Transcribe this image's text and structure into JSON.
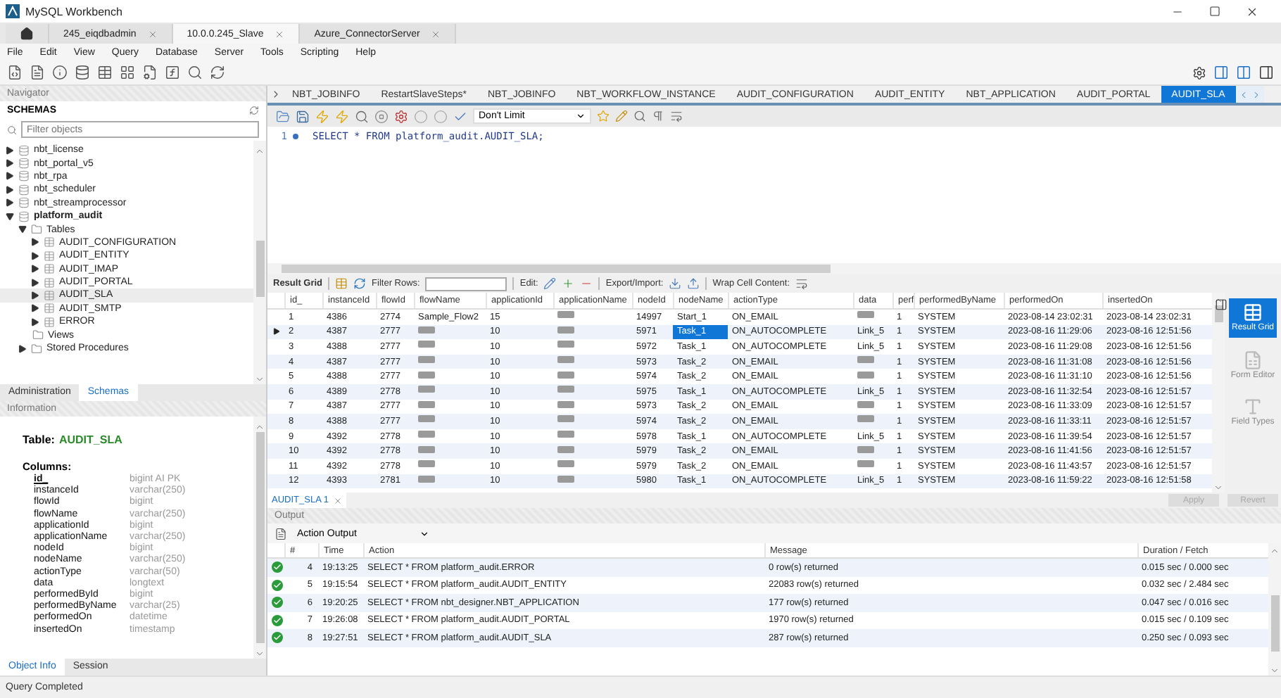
{
  "window": {
    "title": "MySQL Workbench"
  },
  "connection_tabs": [
    {
      "label": "245_eiqdbadmin",
      "selected": false
    },
    {
      "label": "10.0.0.245_Slave",
      "selected": true
    },
    {
      "label": "Azure_ConnectorServer",
      "selected": false
    }
  ],
  "menu": [
    "File",
    "Edit",
    "View",
    "Query",
    "Database",
    "Server",
    "Tools",
    "Scripting",
    "Help"
  ],
  "navigator": {
    "title": "Navigator",
    "section": "SCHEMAS",
    "filter": {
      "placeholder": "Filter objects"
    },
    "tree": [
      {
        "label": "nbt_license",
        "expanded": false
      },
      {
        "label": "nbt_portal_v5",
        "expanded": false
      },
      {
        "label": "nbt_rpa",
        "expanded": false
      },
      {
        "label": "nbt_scheduler",
        "expanded": false
      },
      {
        "label": "nbt_streamprocessor",
        "expanded": false
      },
      {
        "label": "platform_audit",
        "expanded": true,
        "children": [
          {
            "label": "Tables",
            "kind": "folder",
            "expanded": true,
            "children": [
              {
                "label": "AUDIT_CONFIGURATION",
                "kind": "table",
                "selected": false,
                "expanded": false
              },
              {
                "label": "AUDIT_ENTITY",
                "kind": "table",
                "selected": false,
                "expanded": false
              },
              {
                "label": "AUDIT_IMAP",
                "kind": "table",
                "selected": false,
                "expanded": false
              },
              {
                "label": "AUDIT_PORTAL",
                "kind": "table",
                "selected": false,
                "expanded": false
              },
              {
                "label": "AUDIT_SLA",
                "kind": "table",
                "selected": true,
                "expanded": false
              },
              {
                "label": "AUDIT_SMTP",
                "kind": "table",
                "selected": false,
                "expanded": false
              },
              {
                "label": "ERROR",
                "kind": "table",
                "selected": false,
                "expanded": false
              }
            ]
          },
          {
            "label": "Views",
            "kind": "folder"
          },
          {
            "label": "Stored Procedures",
            "kind": "folder",
            "expanded": false
          }
        ]
      }
    ],
    "tabs": [
      {
        "label": "Administration",
        "selected": false
      },
      {
        "label": "Schemas",
        "selected": true
      }
    ]
  },
  "information": {
    "title": "Information",
    "table_label": "Table:",
    "table_name": "AUDIT_SLA",
    "columns_label": "Columns:",
    "columns": [
      {
        "name": "id_",
        "type": "bigint AI PK",
        "primary": true
      },
      {
        "name": "instanceId",
        "type": "varchar(250)",
        "primary": false
      },
      {
        "name": "flowId",
        "type": "bigint",
        "primary": false
      },
      {
        "name": "flowName",
        "type": "varchar(250)",
        "primary": false
      },
      {
        "name": "applicationId",
        "type": "bigint",
        "primary": false
      },
      {
        "name": "applicationName",
        "type": "varchar(250)",
        "primary": false
      },
      {
        "name": "nodeId",
        "type": "bigint",
        "primary": false
      },
      {
        "name": "nodeName",
        "type": "varchar(250)",
        "primary": false
      },
      {
        "name": "actionType",
        "type": "varchar(50)",
        "primary": false
      },
      {
        "name": "data",
        "type": "longtext",
        "primary": false
      },
      {
        "name": "performedById",
        "type": "bigint",
        "primary": false
      },
      {
        "name": "performedByName",
        "type": "varchar(25)",
        "primary": false
      },
      {
        "name": "performedOn",
        "type": "datetime",
        "primary": false
      },
      {
        "name": "insertedOn",
        "type": "timestamp",
        "primary": false
      }
    ],
    "tabs": [
      {
        "label": "Object Info",
        "selected": true
      },
      {
        "label": "Session",
        "selected": false
      }
    ]
  },
  "editor_tabs": [
    {
      "label": "NBT_JOBINFO",
      "selected": false
    },
    {
      "label": "RestartSlaveSteps*",
      "selected": false
    },
    {
      "label": "NBT_JOBINFO",
      "selected": false
    },
    {
      "label": "NBT_WORKFLOW_INSTANCE",
      "selected": false
    },
    {
      "label": "AUDIT_CONFIGURATION",
      "selected": false
    },
    {
      "label": "AUDIT_ENTITY",
      "selected": false
    },
    {
      "label": "NBT_APPLICATION",
      "selected": false
    },
    {
      "label": "AUDIT_PORTAL",
      "selected": false
    },
    {
      "label": "AUDIT_SLA",
      "selected": true
    }
  ],
  "limit_select": {
    "value": "Don't Limit"
  },
  "editor": {
    "lines": [
      {
        "number": "1",
        "code": "SELECT * FROM platform_audit.AUDIT_SLA;"
      }
    ]
  },
  "result_toolbar": {
    "result_grid": "Result Grid",
    "filter_label": "Filter Rows:",
    "edit_label": "Edit:",
    "export_label": "Export/Import:",
    "wrap_label": "Wrap Cell Content:"
  },
  "result_grid": {
    "columns": [
      {
        "label": "id_",
        "selected": false
      },
      {
        "label": "instanceId",
        "selected": false
      },
      {
        "label": "flowId",
        "selected": false
      },
      {
        "label": "flowName",
        "selected": false
      },
      {
        "label": "applicationId",
        "selected": false
      },
      {
        "label": "applicationName",
        "selected": false
      },
      {
        "label": "nodeId",
        "selected": false
      },
      {
        "label": "nodeName",
        "selected": true
      },
      {
        "label": "actionType",
        "selected": false
      },
      {
        "label": "data",
        "selected": false
      },
      {
        "label": "perf",
        "selected": false
      },
      {
        "label": "performedByName",
        "selected": false
      },
      {
        "label": "performedOn",
        "selected": false
      },
      {
        "label": "insertedOn",
        "selected": false
      }
    ],
    "rows": [
      {
        "current": false,
        "cells": [
          "1",
          "4386",
          "2774",
          "Sample_Flow2",
          "15",
          null,
          "14997",
          "Start_1",
          "ON_EMAIL",
          null,
          "1",
          "SYSTEM",
          "2023-08-14 23:02:31",
          "2023-08-14 23:02:31"
        ]
      },
      {
        "current": true,
        "cells": [
          "2",
          "4387",
          "2777",
          null,
          "10",
          null,
          "5971",
          "Task_1",
          "ON_AUTOCOMPLETE",
          "Link_5",
          "1",
          "SYSTEM",
          "2023-08-16 11:29:06",
          "2023-08-16 12:51:56"
        ]
      },
      {
        "current": false,
        "cells": [
          "3",
          "4388",
          "2777",
          null,
          "10",
          null,
          "5972",
          "Task_1",
          "ON_AUTOCOMPLETE",
          "Link_5",
          "1",
          "SYSTEM",
          "2023-08-16 11:29:08",
          "2023-08-16 12:51:56"
        ]
      },
      {
        "current": false,
        "cells": [
          "4",
          "4387",
          "2777",
          null,
          "10",
          null,
          "5973",
          "Task_2",
          "ON_EMAIL",
          null,
          "1",
          "SYSTEM",
          "2023-08-16 11:31:08",
          "2023-08-16 12:51:56"
        ]
      },
      {
        "current": false,
        "cells": [
          "5",
          "4388",
          "2777",
          null,
          "10",
          null,
          "5974",
          "Task_2",
          "ON_EMAIL",
          null,
          "1",
          "SYSTEM",
          "2023-08-16 11:31:10",
          "2023-08-16 12:51:56"
        ]
      },
      {
        "current": false,
        "cells": [
          "6",
          "4389",
          "2778",
          null,
          "10",
          null,
          "5975",
          "Task_1",
          "ON_AUTOCOMPLETE",
          "Link_5",
          "1",
          "SYSTEM",
          "2023-08-16 11:32:54",
          "2023-08-16 12:51:57"
        ]
      },
      {
        "current": false,
        "cells": [
          "7",
          "4387",
          "2777",
          null,
          "10",
          null,
          "5973",
          "Task_2",
          "ON_EMAIL",
          null,
          "1",
          "SYSTEM",
          "2023-08-16 11:33:09",
          "2023-08-16 12:51:57"
        ]
      },
      {
        "current": false,
        "cells": [
          "8",
          "4388",
          "2777",
          null,
          "10",
          null,
          "5974",
          "Task_2",
          "ON_EMAIL",
          null,
          "1",
          "SYSTEM",
          "2023-08-16 11:33:11",
          "2023-08-16 12:51:57"
        ]
      },
      {
        "current": false,
        "cells": [
          "9",
          "4392",
          "2778",
          null,
          "10",
          null,
          "5978",
          "Task_1",
          "ON_AUTOCOMPLETE",
          "Link_5",
          "1",
          "SYSTEM",
          "2023-08-16 11:39:54",
          "2023-08-16 12:51:57"
        ]
      },
      {
        "current": false,
        "cells": [
          "10",
          "4392",
          "2778",
          null,
          "10",
          null,
          "5979",
          "Task_2",
          "ON_EMAIL",
          null,
          "1",
          "SYSTEM",
          "2023-08-16 11:41:56",
          "2023-08-16 12:51:57"
        ]
      },
      {
        "current": false,
        "cells": [
          "11",
          "4392",
          "2778",
          null,
          "10",
          null,
          "5979",
          "Task_2",
          "ON_EMAIL",
          null,
          "1",
          "SYSTEM",
          "2023-08-16 11:43:57",
          "2023-08-16 12:51:57"
        ]
      },
      {
        "current": false,
        "cells": [
          "12",
          "4393",
          "2781",
          null,
          "10",
          null,
          "5980",
          "Task_1",
          "ON_AUTOCOMPLETE",
          "Link_5",
          "1",
          "SYSTEM",
          "2023-08-16 11:59:22",
          "2023-08-16 12:51:58"
        ]
      }
    ]
  },
  "side_panel": [
    {
      "label": "Result Grid",
      "selected": true
    },
    {
      "label": "Form Editor",
      "selected": false
    },
    {
      "label": "Field Types",
      "selected": false
    }
  ],
  "result_tab": {
    "label": "AUDIT_SLA 1"
  },
  "buttons": [
    {
      "label": "Apply",
      "disabled": true
    },
    {
      "label": "Revert",
      "disabled": true
    }
  ],
  "output": {
    "title": "Output",
    "mode": "Action Output",
    "columns": [
      "#",
      "Time",
      "Action",
      "Message",
      "Duration / Fetch"
    ],
    "rows": [
      {
        "success": true,
        "cells": [
          "4",
          "19:13:25",
          "SELECT * FROM platform_audit.ERROR",
          "0 row(s) returned",
          "0.015 sec / 0.000 sec"
        ]
      },
      {
        "success": true,
        "cells": [
          "5",
          "19:15:54",
          "SELECT * FROM platform_audit.AUDIT_ENTITY",
          "22083 row(s) returned",
          "0.032 sec / 2.484 sec"
        ]
      },
      {
        "success": true,
        "cells": [
          "6",
          "19:20:25",
          "SELECT * FROM nbt_designer.NBT_APPLICATION",
          "177 row(s) returned",
          "0.047 sec / 0.016 sec"
        ]
      },
      {
        "success": true,
        "cells": [
          "7",
          "19:26:08",
          "SELECT * FROM platform_audit.AUDIT_PORTAL",
          "1970 row(s) returned",
          "0.015 sec / 0.109 sec"
        ]
      },
      {
        "success": true,
        "cells": [
          "8",
          "19:27:51",
          "SELECT * FROM platform_audit.AUDIT_SLA",
          "287 row(s) returned",
          "0.250 sec / 0.093 sec"
        ]
      }
    ]
  },
  "status_bar": {
    "text": "Query Completed"
  }
}
